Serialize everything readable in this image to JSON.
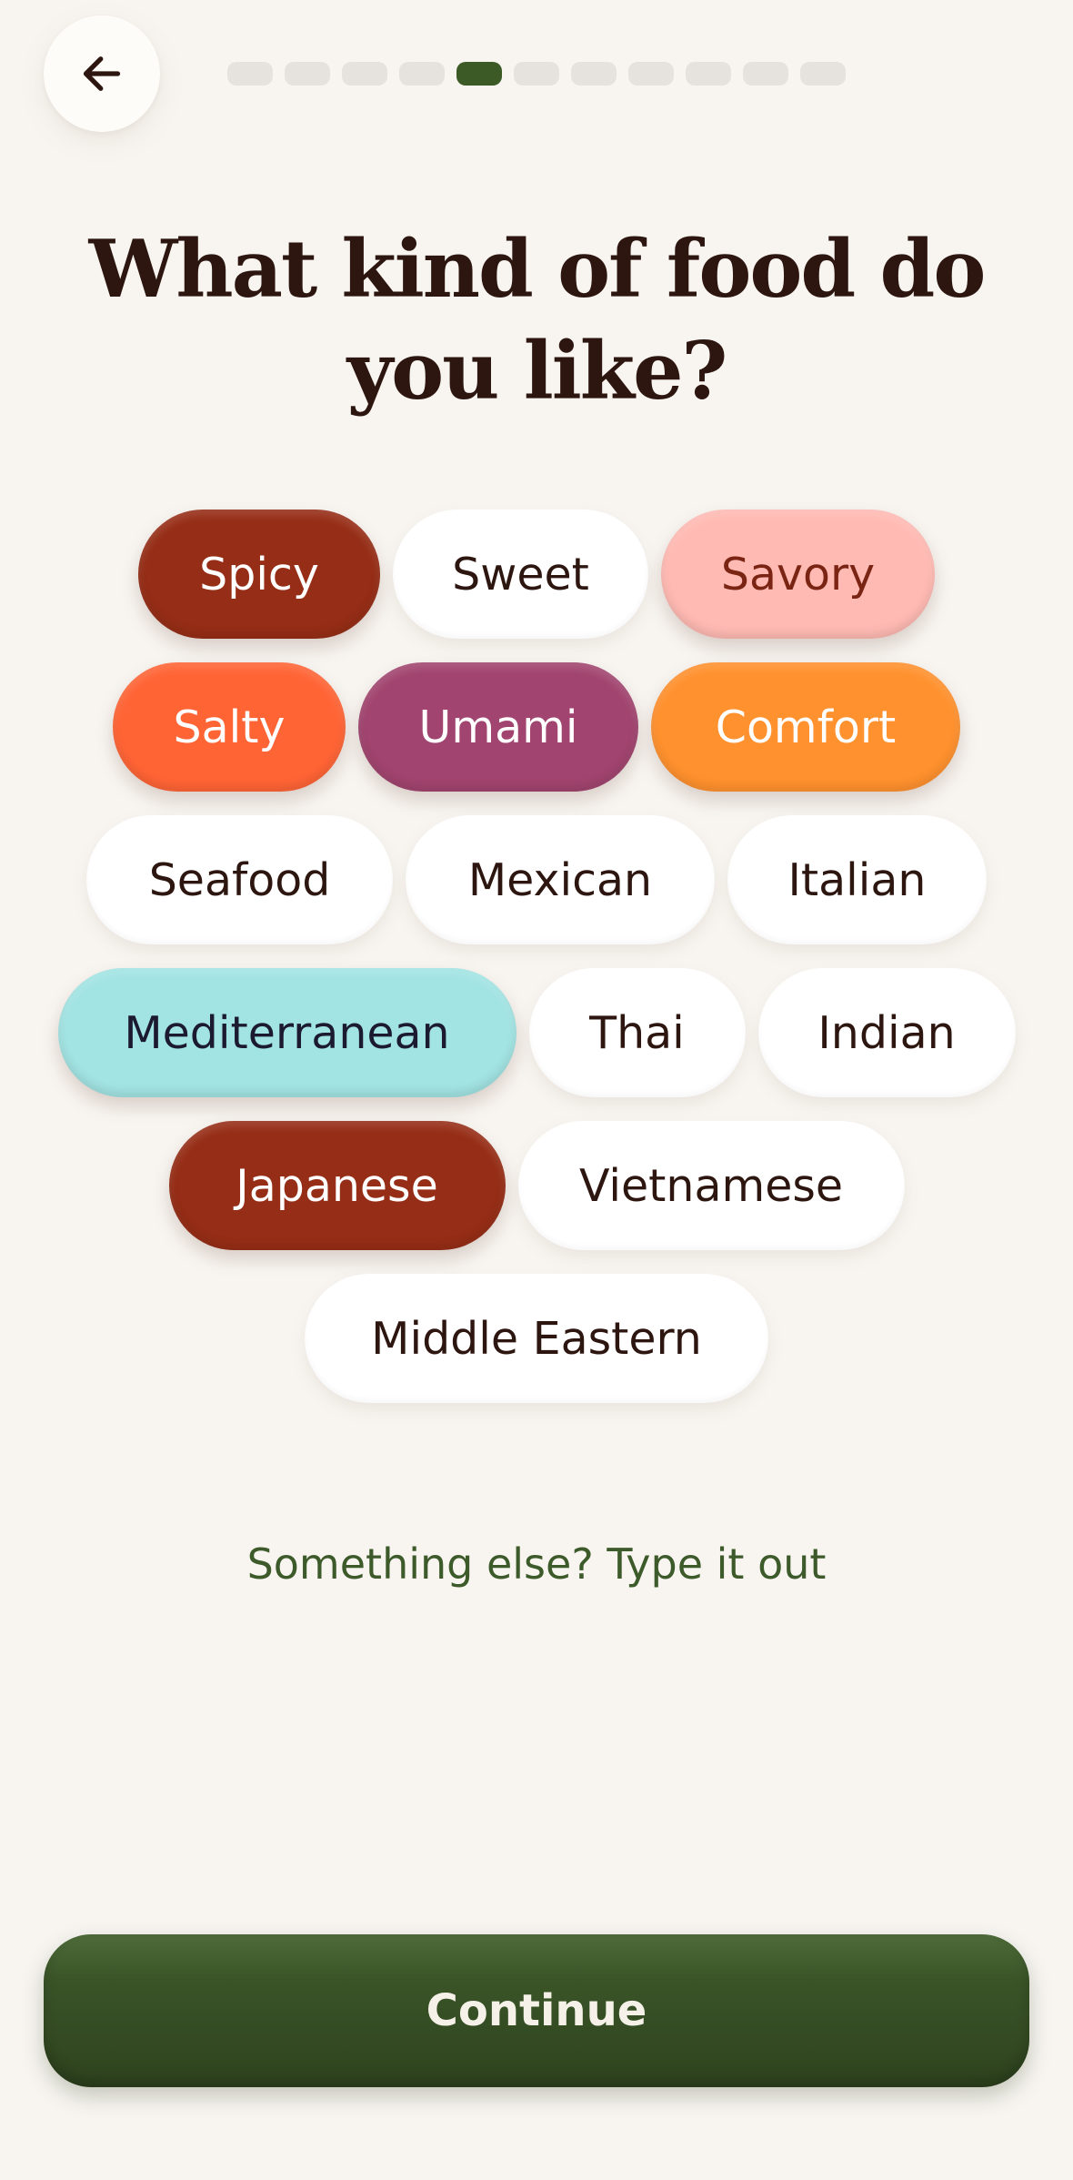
{
  "header": {
    "back_icon": "arrow-left-icon",
    "progress": {
      "total_steps": 11,
      "current_step": 5,
      "active_color": "#3b5a26",
      "inactive_color": "#e6e2de"
    }
  },
  "title": "What kind of food do you like?",
  "chip_rows": [
    [
      {
        "label": "Spicy",
        "selected": true,
        "bg": "#962d16",
        "fg": "#ffffff"
      },
      {
        "label": "Sweet",
        "selected": false,
        "bg": "#ffffff",
        "fg": "#2d1610"
      },
      {
        "label": "Savory",
        "selected": true,
        "bg": "#ffbab3",
        "fg": "#7a2414"
      }
    ],
    [
      {
        "label": "Salty",
        "selected": true,
        "bg": "#ff6435",
        "fg": "#ffffff"
      },
      {
        "label": "Umami",
        "selected": true,
        "bg": "#a1446f",
        "fg": "#ffffff"
      },
      {
        "label": "Comfort",
        "selected": true,
        "bg": "#ff912e",
        "fg": "#ffffff"
      }
    ],
    [
      {
        "label": "Seafood",
        "selected": false,
        "bg": "#ffffff",
        "fg": "#2d1610"
      },
      {
        "label": "Mexican",
        "selected": false,
        "bg": "#ffffff",
        "fg": "#2d1610"
      },
      {
        "label": "Italian",
        "selected": false,
        "bg": "#ffffff",
        "fg": "#2d1610"
      }
    ],
    [
      {
        "label": "Mediterranean",
        "selected": true,
        "bg": "#a2e4e3",
        "fg": "#1c1a30"
      },
      {
        "label": "Thai",
        "selected": false,
        "bg": "#ffffff",
        "fg": "#2d1610"
      },
      {
        "label": "Indian",
        "selected": false,
        "bg": "#ffffff",
        "fg": "#2d1610"
      }
    ],
    [
      {
        "label": "Japanese",
        "selected": true,
        "bg": "#962d16",
        "fg": "#ffffff"
      },
      {
        "label": "Vietnamese",
        "selected": false,
        "bg": "#ffffff",
        "fg": "#2d1610"
      }
    ],
    [
      {
        "label": "Middle Eastern",
        "selected": false,
        "bg": "#ffffff",
        "fg": "#2d1610"
      }
    ]
  ],
  "type_link": "Something else? Type it out",
  "continue_label": "Continue",
  "colors": {
    "background": "#f8f5f1",
    "text": "#2d1610",
    "accent_green": "#3b5a26"
  }
}
